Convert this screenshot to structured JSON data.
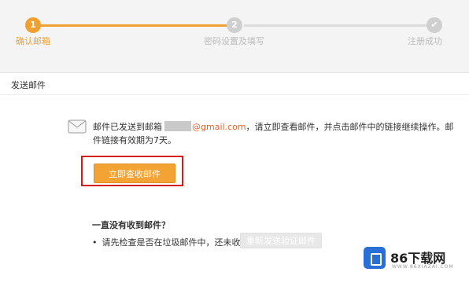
{
  "steps": [
    {
      "number": "1",
      "label": "确认邮箱",
      "active": true
    },
    {
      "number": "2",
      "label": "密码设置及填写",
      "active": false
    },
    {
      "number": "✔",
      "label": "注册成功",
      "active": false
    }
  ],
  "section_title": "发送邮件",
  "message": {
    "prefix": "邮件已发送到邮箱",
    "email_domain": "@gmail.com",
    "suffix": "，请立即查看邮件，并点击邮件中的链接继续操作。邮件链接有效期为7天。"
  },
  "check_button_label": "立即查收邮件",
  "faq": {
    "title": "一直没有收到邮件？",
    "bullet": "•",
    "question": "请先检查是否在垃圾邮件中，还未收到？",
    "resend_label": "重新发送验证邮件"
  },
  "watermark": {
    "brand": "86下载网",
    "sub": "WWW.86XIAZAI.COM"
  },
  "colors": {
    "accent": "#f0a030",
    "highlight": "#d21e1e",
    "email": "#e8632c"
  }
}
